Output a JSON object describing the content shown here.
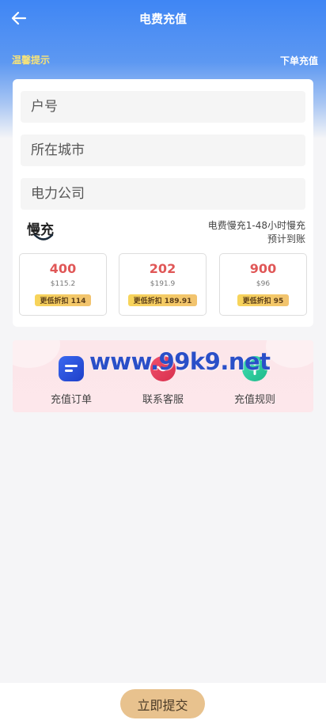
{
  "header": {
    "title": "电费充值",
    "notice_left": "温馨提示",
    "notice_right": "下单充值"
  },
  "form": {
    "account_placeholder": "户号",
    "city_placeholder": "所在城市",
    "company_placeholder": "电力公司"
  },
  "mode": {
    "logo_text": "慢充",
    "desc_line1": "电费慢充1-48小时慢充",
    "desc_line2": "预计到账"
  },
  "amounts": [
    {
      "value": "400",
      "original": "$115.2",
      "badge": "更低折扣 114"
    },
    {
      "value": "202",
      "original": "$191.9",
      "badge": "更低折扣 189.91"
    },
    {
      "value": "900",
      "original": "$96",
      "badge": "更低折扣 95"
    }
  ],
  "services": [
    {
      "label": "充值订单",
      "icon": "order-icon"
    },
    {
      "label": "联系客服",
      "icon": "customer-service-icon"
    },
    {
      "label": "充值规则",
      "icon": "info-icon"
    }
  ],
  "watermark": "www.99k9.net",
  "footer": {
    "submit_label": "立即提交"
  },
  "colors": {
    "header_blue": "#3f86f4",
    "amount_red": "#e05757",
    "badge_yellow": "#f7d45a",
    "submit_bg": "#e8c28e",
    "notice_yellow": "#f5e27a"
  }
}
